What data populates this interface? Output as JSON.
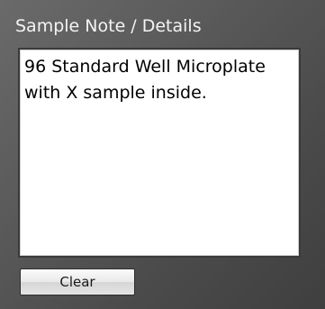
{
  "panel": {
    "title": "Sample Note / Details",
    "note_text": "96 Standard Well Microplate with X sample inside.",
    "clear_label": "Clear"
  },
  "colors": {
    "panel_background": "#555555",
    "title_text": "#f4f4f4",
    "note_background": "#ffffff",
    "note_text": "#000000"
  }
}
